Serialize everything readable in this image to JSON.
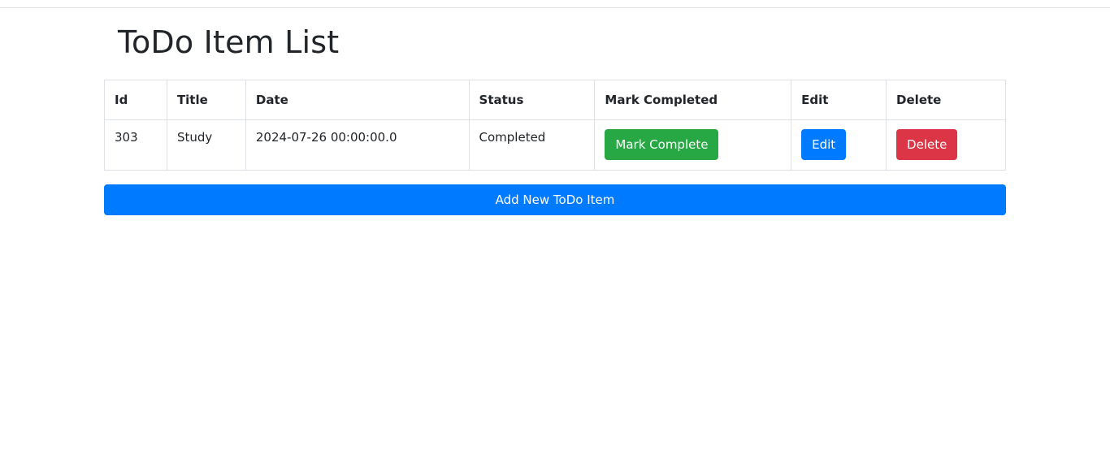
{
  "page": {
    "title": "ToDo Item List"
  },
  "table": {
    "headers": [
      "Id",
      "Title",
      "Date",
      "Status",
      "Mark Completed",
      "Edit",
      "Delete"
    ],
    "rows": [
      {
        "id": "303",
        "title": "Study",
        "date": "2024-07-26 00:00:00.0",
        "status": "Completed",
        "mark_complete_label": "Mark Complete",
        "edit_label": "Edit",
        "delete_label": "Delete"
      }
    ]
  },
  "actions": {
    "add_label": "Add New ToDo Item"
  },
  "colors": {
    "primary": "#007bff",
    "success": "#28a745",
    "danger": "#dc3545",
    "text": "#212529",
    "border": "#dee2e6"
  }
}
